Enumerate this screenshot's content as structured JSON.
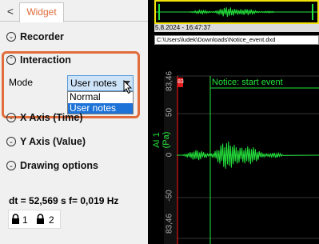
{
  "tabs": {
    "back_glyph": "<",
    "widget_label": "Widget"
  },
  "sections": {
    "recorder": "Recorder",
    "interaction": "Interaction",
    "x_axis": "X Axis (Time)",
    "y_axis": "Y Axis (Value)",
    "drawing_options": "Drawing options"
  },
  "interaction": {
    "mode_label": "Mode",
    "mode_selected": "User notes",
    "mode_options": [
      "Normal",
      "User notes"
    ]
  },
  "stats": {
    "dt_text": "dt = 52,569 s  f= 0,019 Hz"
  },
  "locks": [
    {
      "label": "1"
    },
    {
      "label": "2"
    }
  ],
  "overview": {
    "date_text": "5.8.2024 - 16:47:37",
    "file_path": "C:\\Users\\ludek\\Downloads\\Notice_event.dxd"
  },
  "plot": {
    "y_axis_label": "AI 1 (Pa)",
    "notice_text": "Notice: start event",
    "red_marker_text": "83",
    "ticks": [
      "83,46",
      "50",
      "0",
      "-50",
      "83,46"
    ],
    "colors": {
      "signal": "#23e23b",
      "background": "#000000",
      "overview_border": "#f2e20b",
      "accent": "#e06d3b"
    }
  }
}
